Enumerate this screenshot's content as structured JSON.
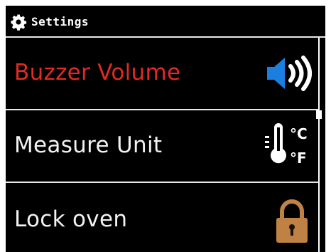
{
  "header": {
    "title": "Settings",
    "icon": "gear-icon"
  },
  "menu": {
    "items": [
      {
        "label": "Buzzer Volume",
        "icon": "speaker-volume-icon",
        "selected": true,
        "label_color": "#e02a22"
      },
      {
        "label": "Measure Unit",
        "icon": "thermometer-unit-icon",
        "selected": false,
        "unit_symbols": [
          "°C",
          "°F"
        ]
      },
      {
        "label": "Lock oven",
        "icon": "padlock-icon",
        "selected": false
      }
    ]
  },
  "colors": {
    "background": "#000000",
    "text": "#f2f2f2",
    "selected": "#e02a22",
    "speaker_blue": "#1a7fe0",
    "lock_brown": "#c08244"
  }
}
